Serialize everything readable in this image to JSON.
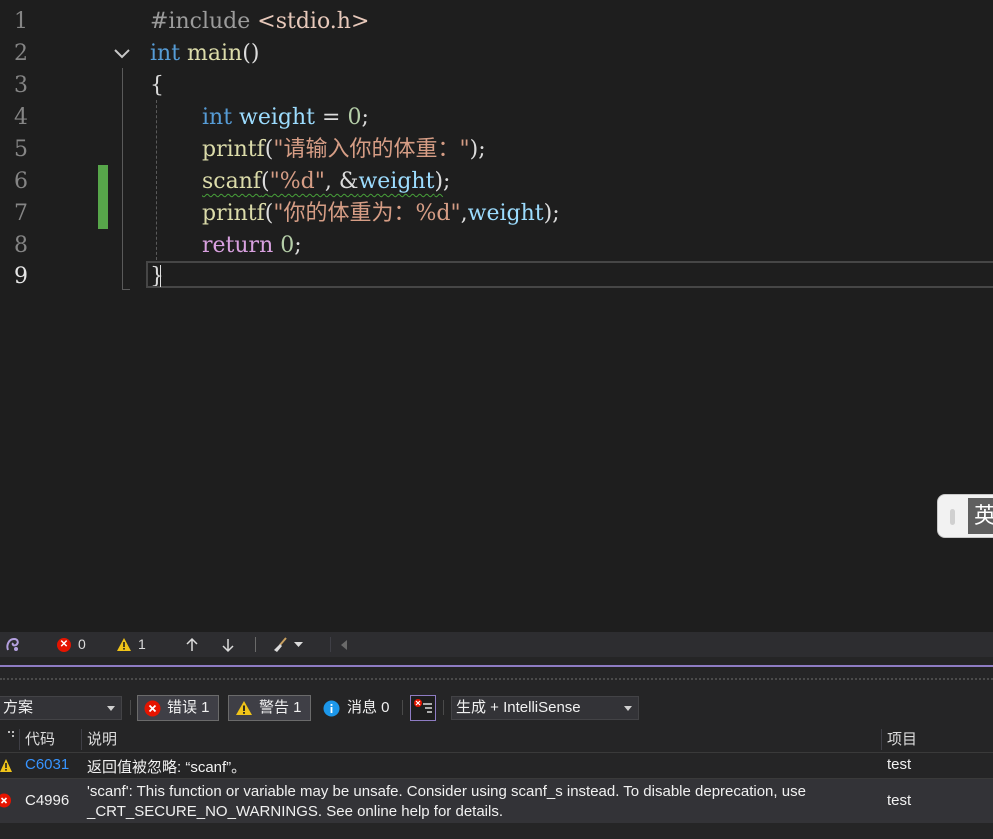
{
  "editor": {
    "lines": [
      {
        "num": "1",
        "tokens": [
          {
            "t": "#include ",
            "c": "pre"
          },
          {
            "t": "<stdio.h>",
            "c": "inc"
          }
        ]
      },
      {
        "num": "2",
        "tokens": [
          {
            "t": "int",
            "c": "kw"
          },
          {
            "t": " ",
            "c": ""
          },
          {
            "t": "main",
            "c": "fn"
          },
          {
            "t": "()",
            "c": ""
          }
        ]
      },
      {
        "num": "3",
        "tokens": [
          {
            "t": "{",
            "c": ""
          }
        ]
      },
      {
        "num": "4",
        "indent": true,
        "tokens": [
          {
            "t": "int",
            "c": "kw"
          },
          {
            "t": " ",
            "c": ""
          },
          {
            "t": "weight",
            "c": "var"
          },
          {
            "t": " = ",
            "c": ""
          },
          {
            "t": "0",
            "c": "num"
          },
          {
            "t": ";",
            "c": ""
          }
        ]
      },
      {
        "num": "5",
        "indent": true,
        "tokens": [
          {
            "t": "printf",
            "c": "fn"
          },
          {
            "t": "(",
            "c": ""
          },
          {
            "t": "\"请输入你的体重：\"",
            "c": "str"
          },
          {
            "t": ");",
            "c": ""
          }
        ]
      },
      {
        "num": "6",
        "indent": true,
        "tokens": [
          {
            "t": "scanf",
            "c": "fn squiggle"
          },
          {
            "t": "(",
            "c": "squiggle"
          },
          {
            "t": "\"%d\"",
            "c": "str squiggle"
          },
          {
            "t": ", &",
            "c": "squiggle"
          },
          {
            "t": "weight",
            "c": "var squiggle"
          },
          {
            "t": ")",
            "c": "squiggle"
          },
          {
            "t": ";",
            "c": ""
          }
        ]
      },
      {
        "num": "7",
        "indent": true,
        "tokens": [
          {
            "t": "printf",
            "c": "fn"
          },
          {
            "t": "(",
            "c": ""
          },
          {
            "t": "\"你的体重为：%d\"",
            "c": "str"
          },
          {
            "t": ",",
            "c": ""
          },
          {
            "t": "weight",
            "c": "var"
          },
          {
            "t": ");",
            "c": ""
          }
        ]
      },
      {
        "num": "8",
        "indent": true,
        "tokens": [
          {
            "t": "return",
            "c": "ctl"
          },
          {
            "t": " ",
            "c": ""
          },
          {
            "t": "0",
            "c": "num"
          },
          {
            "t": ";",
            "c": ""
          }
        ]
      },
      {
        "num": "9",
        "active": true,
        "tokens": [
          {
            "t": "}",
            "c": ""
          }
        ]
      }
    ],
    "ime_mode": "英"
  },
  "status": {
    "errors": "0",
    "warnings": "1"
  },
  "error_list": {
    "scope_value": "方案",
    "filter_errors": "错误 1",
    "filter_warnings": "警告 1",
    "filter_messages": "消息 0",
    "source_value": "生成 + IntelliSense",
    "columns": {
      "code": "代码",
      "description": "说明",
      "project": "项目"
    },
    "rows": [
      {
        "severity": "warning",
        "code": "C6031",
        "description": "返回值被忽略: “scanf”。",
        "project": "test"
      },
      {
        "severity": "error",
        "code": "C4996",
        "description": "'scanf': This function or variable may be unsafe. Consider using scanf_s instead. To disable deprecation, use _CRT_SECURE_NO_WARNINGS. See online help for details.",
        "project": "test"
      }
    ]
  },
  "colors": {
    "accent": "#8e7cc3",
    "error": "#e51400",
    "warning": "#f0c419",
    "change_bar": "#57a64a",
    "link": "#3794ff"
  }
}
